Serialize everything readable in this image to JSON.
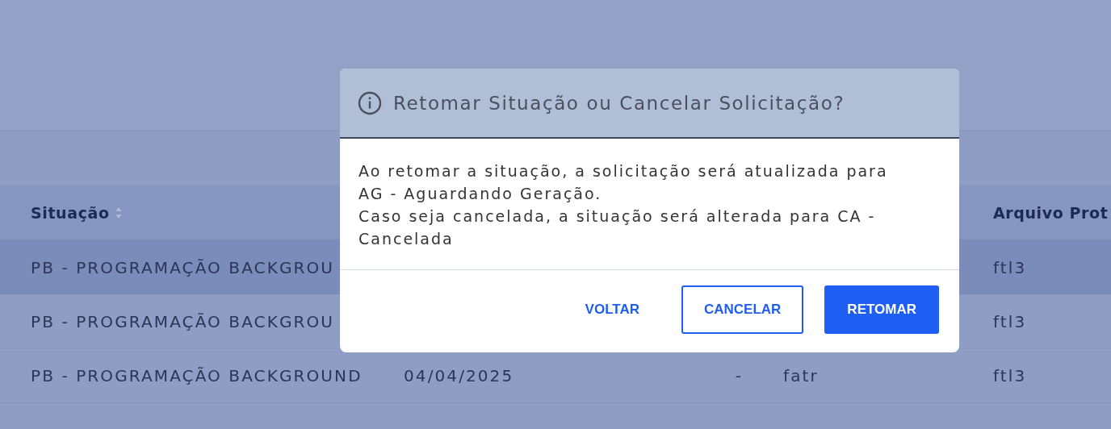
{
  "table": {
    "columns": [
      {
        "label": "Situação",
        "sortable": true
      },
      null,
      null,
      null,
      {
        "label": "Arquivo Prot"
      }
    ],
    "rows": [
      {
        "selected": true,
        "cells": [
          "PB - PROGRAMAÇÃO BACKGROU",
          null,
          null,
          null,
          "ftl3"
        ]
      },
      {
        "selected": false,
        "cells": [
          "PB - PROGRAMAÇÃO BACKGROU",
          null,
          null,
          null,
          "ftl3"
        ]
      },
      {
        "selected": false,
        "cells": [
          "PB - PROGRAMAÇÃO BACKGROUND",
          "04/04/2025",
          "-",
          "fatr",
          "ftl3"
        ]
      }
    ]
  },
  "dialog": {
    "title": "Retomar Situação ou Cancelar Solicitação?",
    "message": [
      "Ao retomar a situação, a solicitação será atualizada para AG - Aguardando Geração.",
      "Caso seja cancelada, a situação será alterada para CA - Cancelada"
    ],
    "buttons": [
      {
        "label": "VOLTAR",
        "kind": "text"
      },
      {
        "label": "CANCELAR",
        "kind": "outline"
      },
      {
        "label": "RETOMAR",
        "kind": "primary"
      }
    ]
  }
}
